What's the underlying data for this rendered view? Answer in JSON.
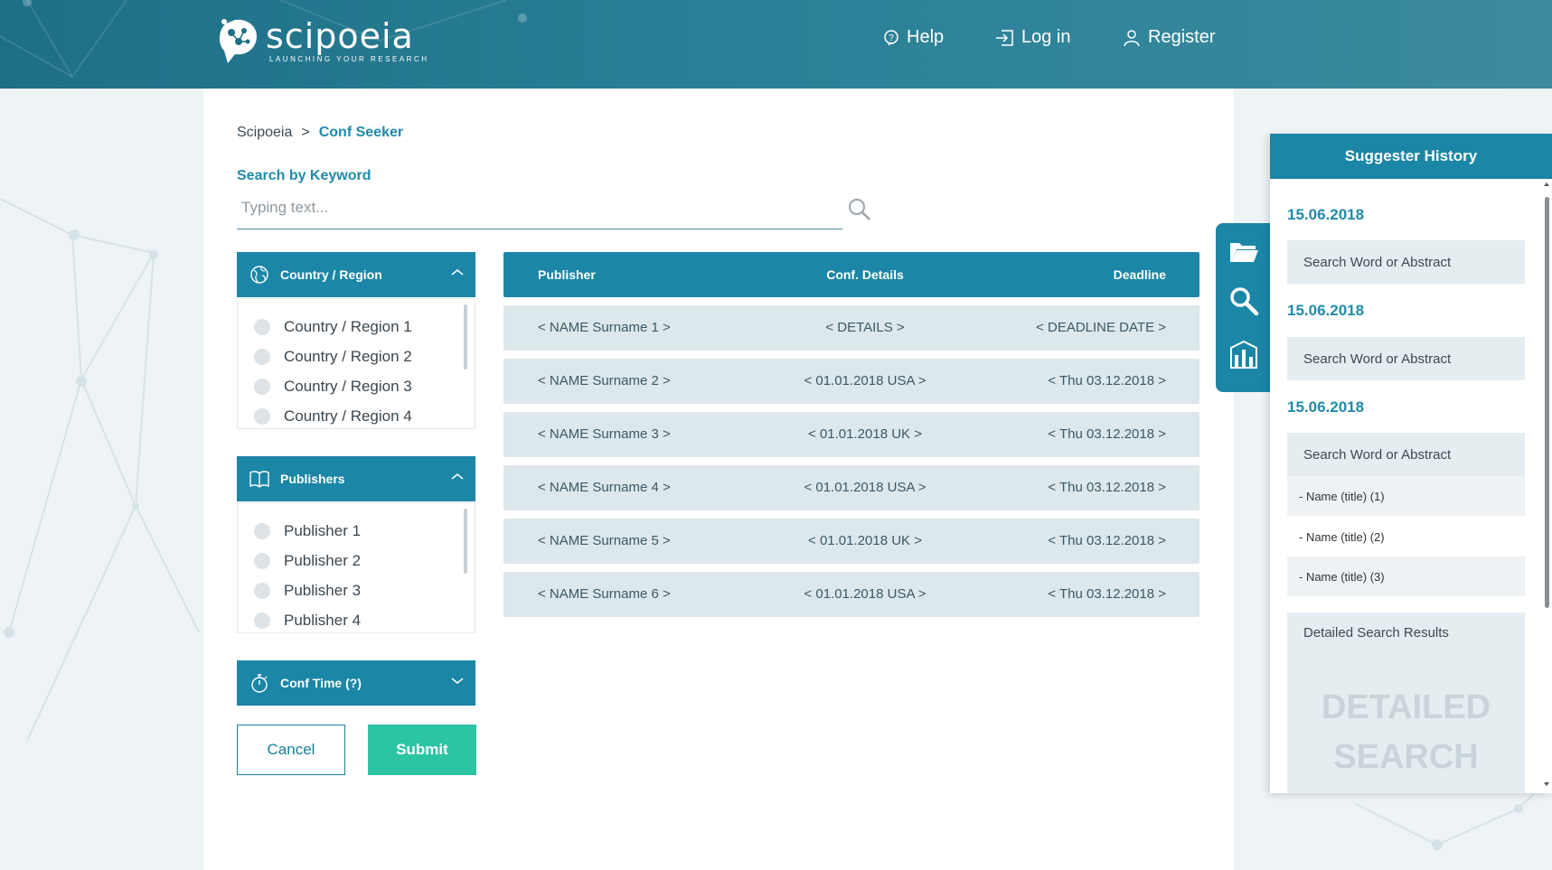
{
  "header": {
    "logo_name": "scipoeia",
    "logo_tagline": "LAUNCHING YOUR RESEARCH",
    "nav": [
      {
        "label": "Help",
        "icon": "help-icon"
      },
      {
        "label": "Log in",
        "icon": "login-icon"
      },
      {
        "label": "Register",
        "icon": "user-icon"
      }
    ]
  },
  "breadcrumb": {
    "root": "Scipoeia",
    "separator": ">",
    "current": "Conf Seeker"
  },
  "search": {
    "label": "Search by Keyword",
    "placeholder": "Typing text..."
  },
  "filters": {
    "country": {
      "title": "Country / Region",
      "icon": "globe-icon",
      "expanded": true,
      "items": [
        "Country / Region 1",
        "Country / Region 2",
        "Country / Region 3",
        "Country / Region 4"
      ]
    },
    "publishers": {
      "title": "Publishers",
      "icon": "book-icon",
      "expanded": true,
      "items": [
        "Publisher 1",
        "Publisher 2",
        "Publisher 3",
        "Publisher 4"
      ]
    },
    "conf_time": {
      "title": "Conf Time (?)",
      "icon": "stopwatch-icon",
      "expanded": false
    }
  },
  "actions": {
    "cancel": "Cancel",
    "submit": "Submit"
  },
  "table": {
    "headers": [
      "Publisher",
      "Conf. Details",
      "Deadline"
    ],
    "rows": [
      [
        "< NAME Surname 1 >",
        "< DETAILS >",
        "< DEADLINE DATE >"
      ],
      [
        "< NAME Surname 2 >",
        "< 01.01.2018 USA >",
        "< Thu 03.12.2018 >"
      ],
      [
        "< NAME Surname 3 >",
        "< 01.01.2018 UK >",
        "< Thu 03.12.2018 >"
      ],
      [
        "< NAME Surname 4 >",
        "< 01.01.2018 USA >",
        "< Thu 03.12.2018 >"
      ],
      [
        "< NAME Surname 5 >",
        "< 01.01.2018 UK >",
        "< Thu 03.12.2018 >"
      ],
      [
        "< NAME Surname 6 >",
        "< 01.01.2018 USA >",
        "< Thu 03.12.2018 >"
      ]
    ]
  },
  "tools": [
    "folder-icon",
    "search-icon",
    "chart-icon"
  ],
  "history": {
    "title": "Suggester History",
    "entries": [
      {
        "date": "15.06.2018",
        "query": "Search Word or Abstract"
      },
      {
        "date": "15.06.2018",
        "query": "Search Word or Abstract"
      },
      {
        "date": "15.06.2018",
        "query": "Search Word or Abstract"
      }
    ],
    "sub_items": [
      "- Name (title) (1)",
      "- Name (title) (2)",
      "- Name (title) (3)"
    ],
    "detailed_label": "Detailed Search Results",
    "detailed_placeholder": "DETAILED SEARCH RESULTS"
  },
  "colors": {
    "header": "#1e6f86",
    "accent": "#1b86a6",
    "submit": "#2bc5a4",
    "row_bg": "#dce8ec"
  }
}
